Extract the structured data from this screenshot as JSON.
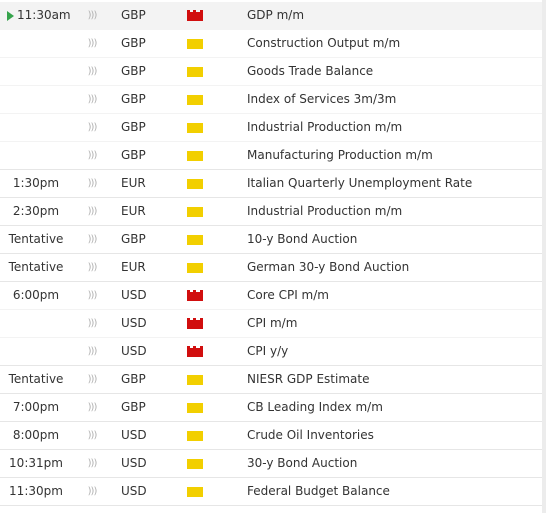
{
  "calendar": {
    "rows": [
      {
        "time": "11:30am",
        "currency": "GBP",
        "impact": "high",
        "event": "GDP m/m",
        "active": true
      },
      {
        "time": "",
        "currency": "GBP",
        "impact": "medium",
        "event": "Construction Output m/m"
      },
      {
        "time": "",
        "currency": "GBP",
        "impact": "medium",
        "event": "Goods Trade Balance"
      },
      {
        "time": "",
        "currency": "GBP",
        "impact": "medium",
        "event": "Index of Services 3m/3m"
      },
      {
        "time": "",
        "currency": "GBP",
        "impact": "medium",
        "event": "Industrial Production m/m"
      },
      {
        "time": "",
        "currency": "GBP",
        "impact": "medium",
        "event": "Manufacturing Production m/m"
      },
      {
        "time": "1:30pm",
        "currency": "EUR",
        "impact": "medium",
        "event": "Italian Quarterly Unemployment Rate"
      },
      {
        "time": "2:30pm",
        "currency": "EUR",
        "impact": "medium",
        "event": "Industrial Production m/m"
      },
      {
        "time": "Tentative",
        "currency": "GBP",
        "impact": "medium",
        "event": "10-y Bond Auction"
      },
      {
        "time": "Tentative",
        "currency": "EUR",
        "impact": "medium",
        "event": "German 30-y Bond Auction"
      },
      {
        "time": "6:00pm",
        "currency": "USD",
        "impact": "high",
        "event": "Core CPI m/m"
      },
      {
        "time": "",
        "currency": "USD",
        "impact": "high",
        "event": "CPI m/m"
      },
      {
        "time": "",
        "currency": "USD",
        "impact": "high",
        "event": "CPI y/y"
      },
      {
        "time": "Tentative",
        "currency": "GBP",
        "impact": "medium",
        "event": "NIESR GDP Estimate"
      },
      {
        "time": "7:00pm",
        "currency": "GBP",
        "impact": "medium",
        "event": "CB Leading Index m/m"
      },
      {
        "time": "8:00pm",
        "currency": "USD",
        "impact": "medium",
        "event": "Crude Oil Inventories"
      },
      {
        "time": "10:31pm",
        "currency": "USD",
        "impact": "medium",
        "event": "30-y Bond Auction"
      },
      {
        "time": "11:30pm",
        "currency": "USD",
        "impact": "medium",
        "event": "Federal Budget Balance"
      }
    ],
    "detail_icon": "wave-icon",
    "colors": {
      "high": "#d10e0e",
      "medium": "#f2cf00",
      "active_marker": "#35a34b"
    }
  }
}
